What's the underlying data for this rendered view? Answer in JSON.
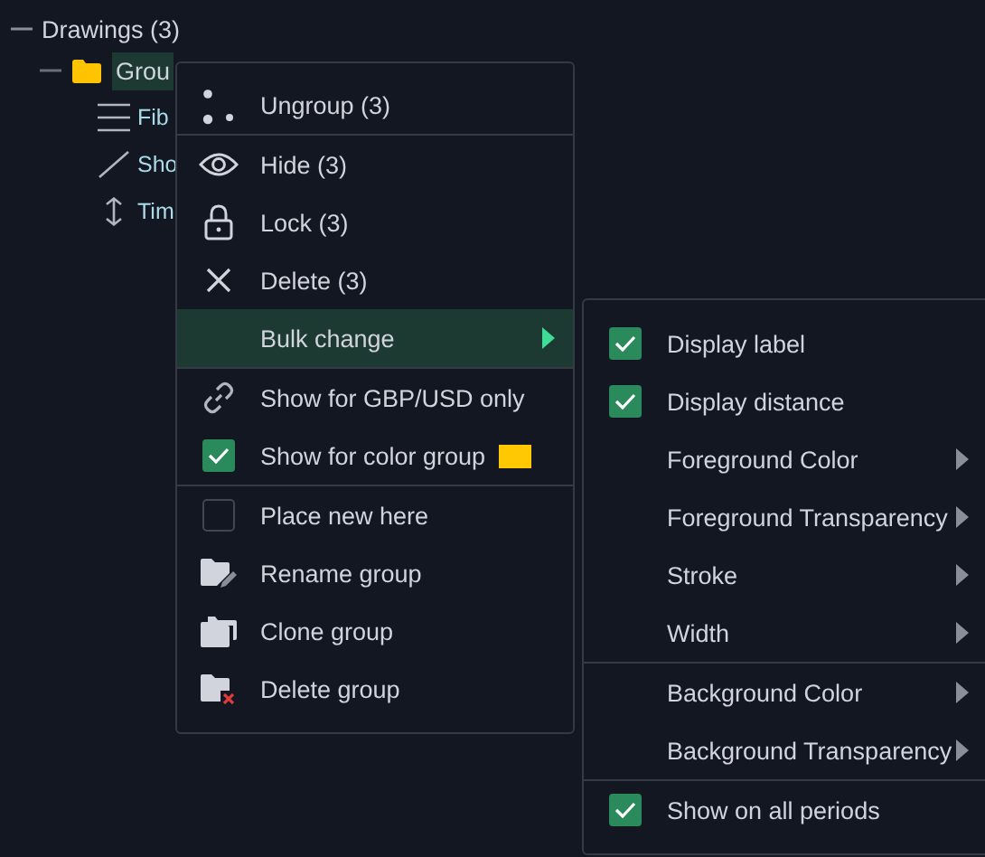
{
  "tree": {
    "label": "Drawings (3)",
    "expanded": true,
    "children": [
      {
        "label": "Grou",
        "kind": "folder",
        "selected": true,
        "expanded": true,
        "children": [
          {
            "label": "Fib",
            "kind": "fib"
          },
          {
            "label": "Sho",
            "kind": "line"
          },
          {
            "label": "Tim",
            "kind": "range"
          }
        ]
      }
    ]
  },
  "context_menu": {
    "sections": [
      [
        {
          "label": "Ungroup (3)",
          "kind": "action",
          "selected": false
        }
      ],
      [
        {
          "label": "Hide (3)",
          "kind": "action",
          "selected": false
        },
        {
          "label": "Lock (3)",
          "kind": "action",
          "selected": false
        },
        {
          "label": "Delete (3)",
          "kind": "action",
          "selected": false
        },
        {
          "label": "Bulk change",
          "kind": "submenu",
          "selected": true
        }
      ],
      [
        {
          "label": "Show for GBP/USD only",
          "kind": "action",
          "selected": false
        },
        {
          "label": "Show for color group",
          "kind": "check",
          "checked": true,
          "color": "#ffc800",
          "selected": false
        }
      ],
      [
        {
          "label": "Place new here",
          "kind": "check",
          "checked": false,
          "selected": false
        },
        {
          "label": "Rename group",
          "kind": "action",
          "selected": false
        },
        {
          "label": "Clone group",
          "kind": "action",
          "selected": false
        },
        {
          "label": "Delete group",
          "kind": "action",
          "selected": false
        }
      ]
    ]
  },
  "submenu": {
    "sections": [
      [
        {
          "label": "Display label",
          "kind": "check",
          "checked": true,
          "selected": false
        },
        {
          "label": "Display distance",
          "kind": "check",
          "checked": true,
          "selected": false
        },
        {
          "label": "Foreground Color",
          "kind": "submenu",
          "selected": false
        },
        {
          "label": "Foreground Transparency",
          "kind": "submenu",
          "selected": false
        },
        {
          "label": "Stroke",
          "kind": "submenu",
          "selected": false
        },
        {
          "label": "Width",
          "kind": "submenu",
          "selected": false
        }
      ],
      [
        {
          "label": "Background Color",
          "kind": "submenu",
          "selected": false
        },
        {
          "label": "Background Transparency",
          "kind": "submenu",
          "selected": false
        }
      ],
      [
        {
          "label": "Show on all periods",
          "kind": "check",
          "checked": true,
          "selected": false
        }
      ]
    ]
  }
}
